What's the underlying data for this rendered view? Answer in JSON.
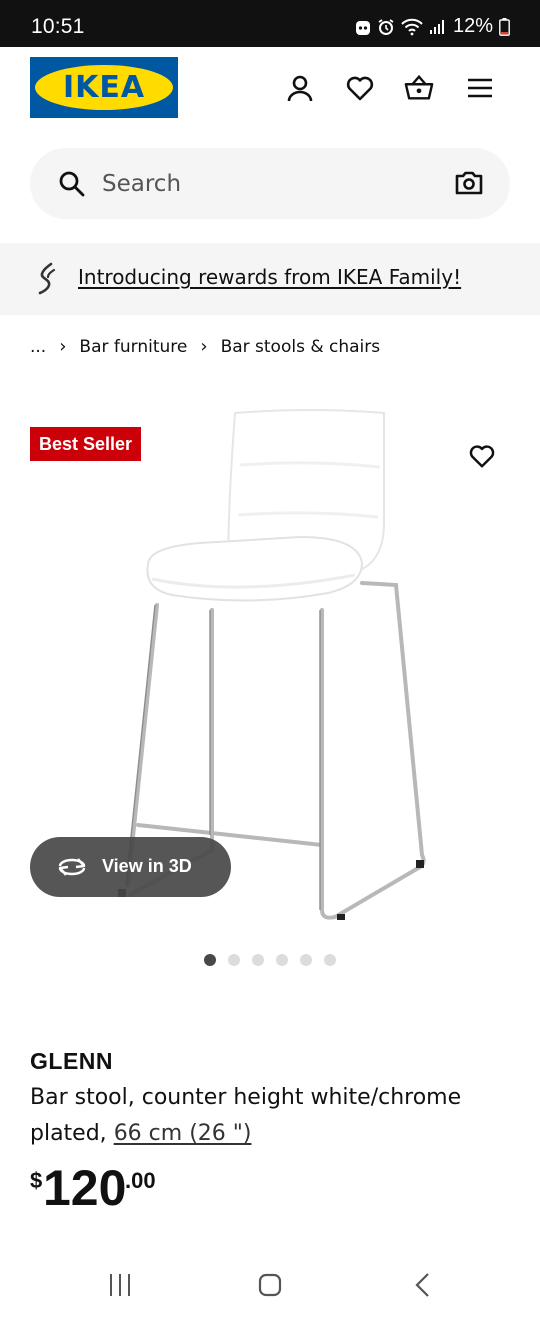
{
  "status_bar": {
    "time": "10:51",
    "battery": "12%"
  },
  "header": {
    "logo_text": "IKEA",
    "icons": [
      "profile-icon",
      "heart-icon",
      "shopping-bag-icon",
      "menu-icon"
    ]
  },
  "search": {
    "placeholder": "Search"
  },
  "promo": {
    "text": "Introducing rewards from IKEA Family!"
  },
  "breadcrumb": {
    "ellipsis": "...",
    "items": [
      "Bar furniture",
      "Bar stools & chairs"
    ]
  },
  "gallery": {
    "badge": "Best Seller",
    "view_3d_label": "View in 3D",
    "image_count": 6,
    "active_index": 0
  },
  "product": {
    "name": "GLENN",
    "description": "Bar stool, counter height white/chrome plated,",
    "size": "66 cm (26 \")",
    "price_currency": "$",
    "price_integer": "120",
    "price_decimal": ".00"
  },
  "colors": {
    "ikea_blue": "#0058a3",
    "ikea_yellow": "#ffdb00",
    "badge_red": "#cc0008"
  }
}
